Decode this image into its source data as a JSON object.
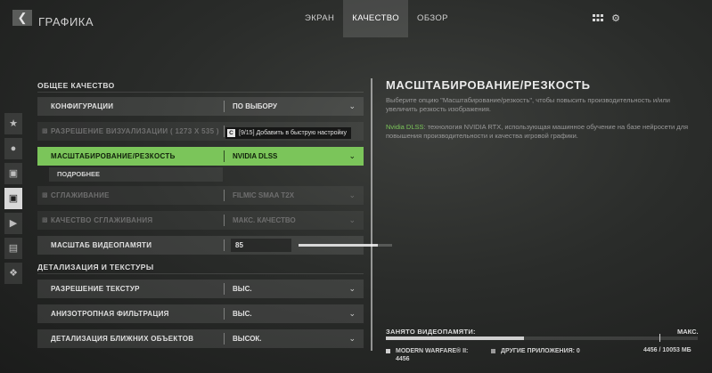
{
  "header": {
    "back_icon": "chevron-left-icon",
    "title": "ГРАФИКА",
    "tabs": [
      {
        "label": "ЭКРАН",
        "active": false
      },
      {
        "label": "КАЧЕСТВО",
        "active": true
      },
      {
        "label": "ОБЗОР",
        "active": false
      }
    ],
    "icons": [
      "grid-icon",
      "gear-icon"
    ]
  },
  "sidebar": {
    "items": [
      {
        "icon": "star-icon"
      },
      {
        "icon": "figure-icon"
      },
      {
        "icon": "controller-icon"
      },
      {
        "icon": "display-slash-icon",
        "active": true
      },
      {
        "icon": "speaker-icon"
      },
      {
        "icon": "window-icon"
      },
      {
        "icon": "network-icon"
      }
    ]
  },
  "sections": {
    "general": "ОБЩЕЕ КАЧЕСТВО",
    "details": "ДЕТАЛИЗАЦИЯ И ТЕКСТУРЫ"
  },
  "settings": {
    "config": {
      "label": "КОНФИГУРАЦИИ",
      "value": "ПО ВЫБОРУ"
    },
    "render_res": {
      "label": "РАЗРЕШЕНИЕ ВИЗУАЛИЗАЦИИ ( 1273 X 535 )",
      "value": ""
    },
    "upscaling": {
      "label": "МАСШТАБИРОВАНИЕ/РЕЗКОСТЬ",
      "value": "NVIDIA DLSS"
    },
    "more": {
      "label": "ПОДРОБНЕЕ"
    },
    "antialiasing": {
      "label": "СГЛАЖИВАНИЕ",
      "value": "FILMIC SMAA T2X"
    },
    "aa_quality": {
      "label": "КАЧЕСТВО СГЛАЖИВАНИЯ",
      "value": "МАКС. КАЧЕСТВО"
    },
    "vram_scale": {
      "label": "МАСШТАБ ВИДЕОПАМЯТИ",
      "value": "85",
      "level_percent": 85
    },
    "texture_res": {
      "label": "РАЗРЕШЕНИЕ ТЕКСТУР",
      "value": "ВЫС."
    },
    "anisotropic": {
      "label": "АНИЗОТРОПНАЯ ФИЛЬТРАЦИЯ",
      "value": "ВЫС."
    },
    "near_detail": {
      "label": "ДЕТАЛИЗАЦИЯ БЛИЖНИХ ОБЪЕКТОВ",
      "value": "ВЫСОК."
    }
  },
  "tooltip": {
    "key": "C",
    "text": "[9/15] Добавить в быструю настройку"
  },
  "detail": {
    "title": "МАСШТАБИРОВАНИЕ/РЕЗКОСТЬ",
    "description": "Выберите опцию \"Масштабирование/резкость\", чтобы повысить производительность и/или увеличить резкость изображения.",
    "dlss_name": "Nvidia DLSS",
    "dlss_text": ": технология NVIDIA RTX, использующая машинное обучение на базе нейросети для повышения производительности и качества игровой графики.",
    "accent_color": "#7bc55a"
  },
  "vram": {
    "label": "ЗАНЯТО ВИДЕОПАМЯТИ:",
    "max_label": "МАКС.",
    "game_label": "MODERN WARFARE® II:",
    "game_value": "4456",
    "other_label": "ДРУГИЕ ПРИЛОЖЕНИЯ: 0",
    "total": "4456 / 10053 МБ",
    "used_mb": 4456,
    "total_mb": 10053
  }
}
